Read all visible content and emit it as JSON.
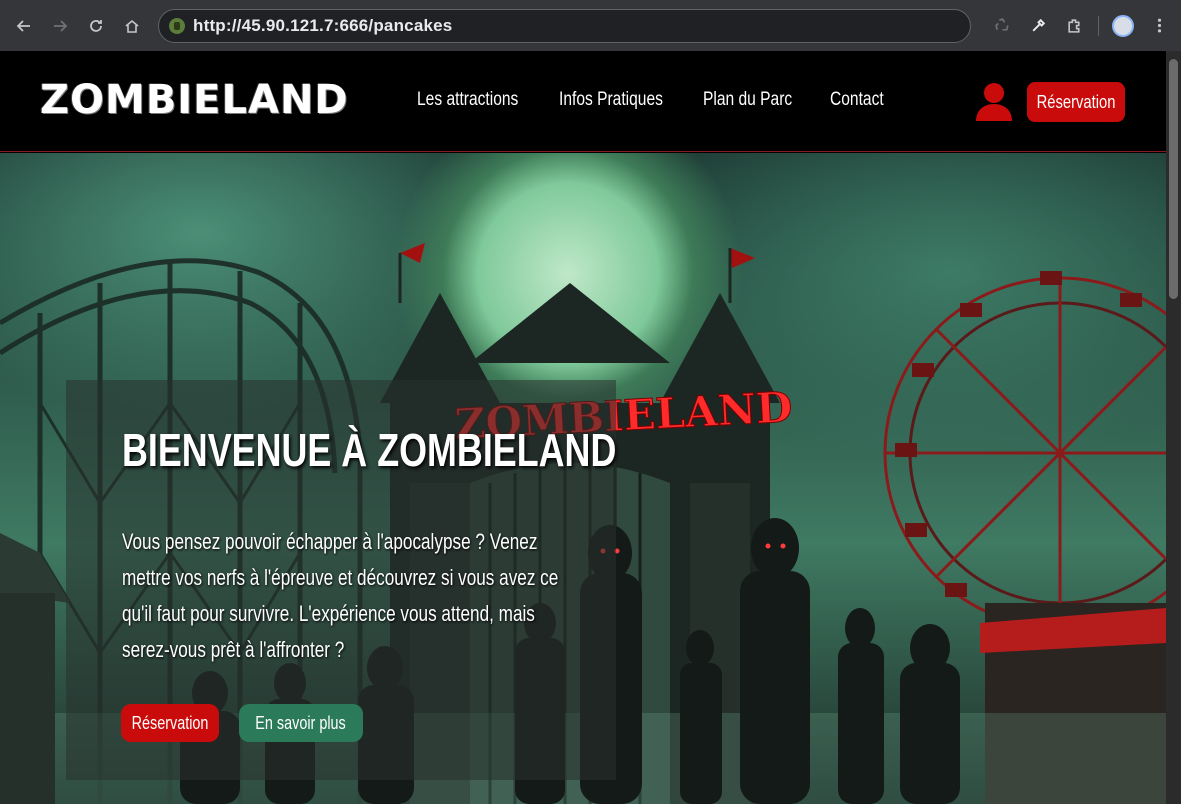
{
  "browser": {
    "url": "http://45.90.121.7:666/pancakes"
  },
  "header": {
    "logo": "ZOMBIELAND",
    "nav": [
      "Les attractions",
      "Infos Pratiques",
      "Plan du Parc",
      "Contact"
    ],
    "reservation_label": "Réservation"
  },
  "hero": {
    "sign_text": "ZOMBIELAND",
    "title": "BIENVENUE À ZOMBIELAND",
    "text": "Vous pensez pouvoir échapper à l'apocalypse ? Venez mettre vos nerfs à l'épreuve et découvrez si vous avez ce qu'il faut pour survivre. L'expérience vous attend, mais serez-vous prêt à l'affronter ?",
    "btn_reservation": "Réservation",
    "btn_more": "En savoir plus"
  },
  "colors": {
    "brand_red": "#c90b0b",
    "accent_green": "#2b7a5a"
  }
}
